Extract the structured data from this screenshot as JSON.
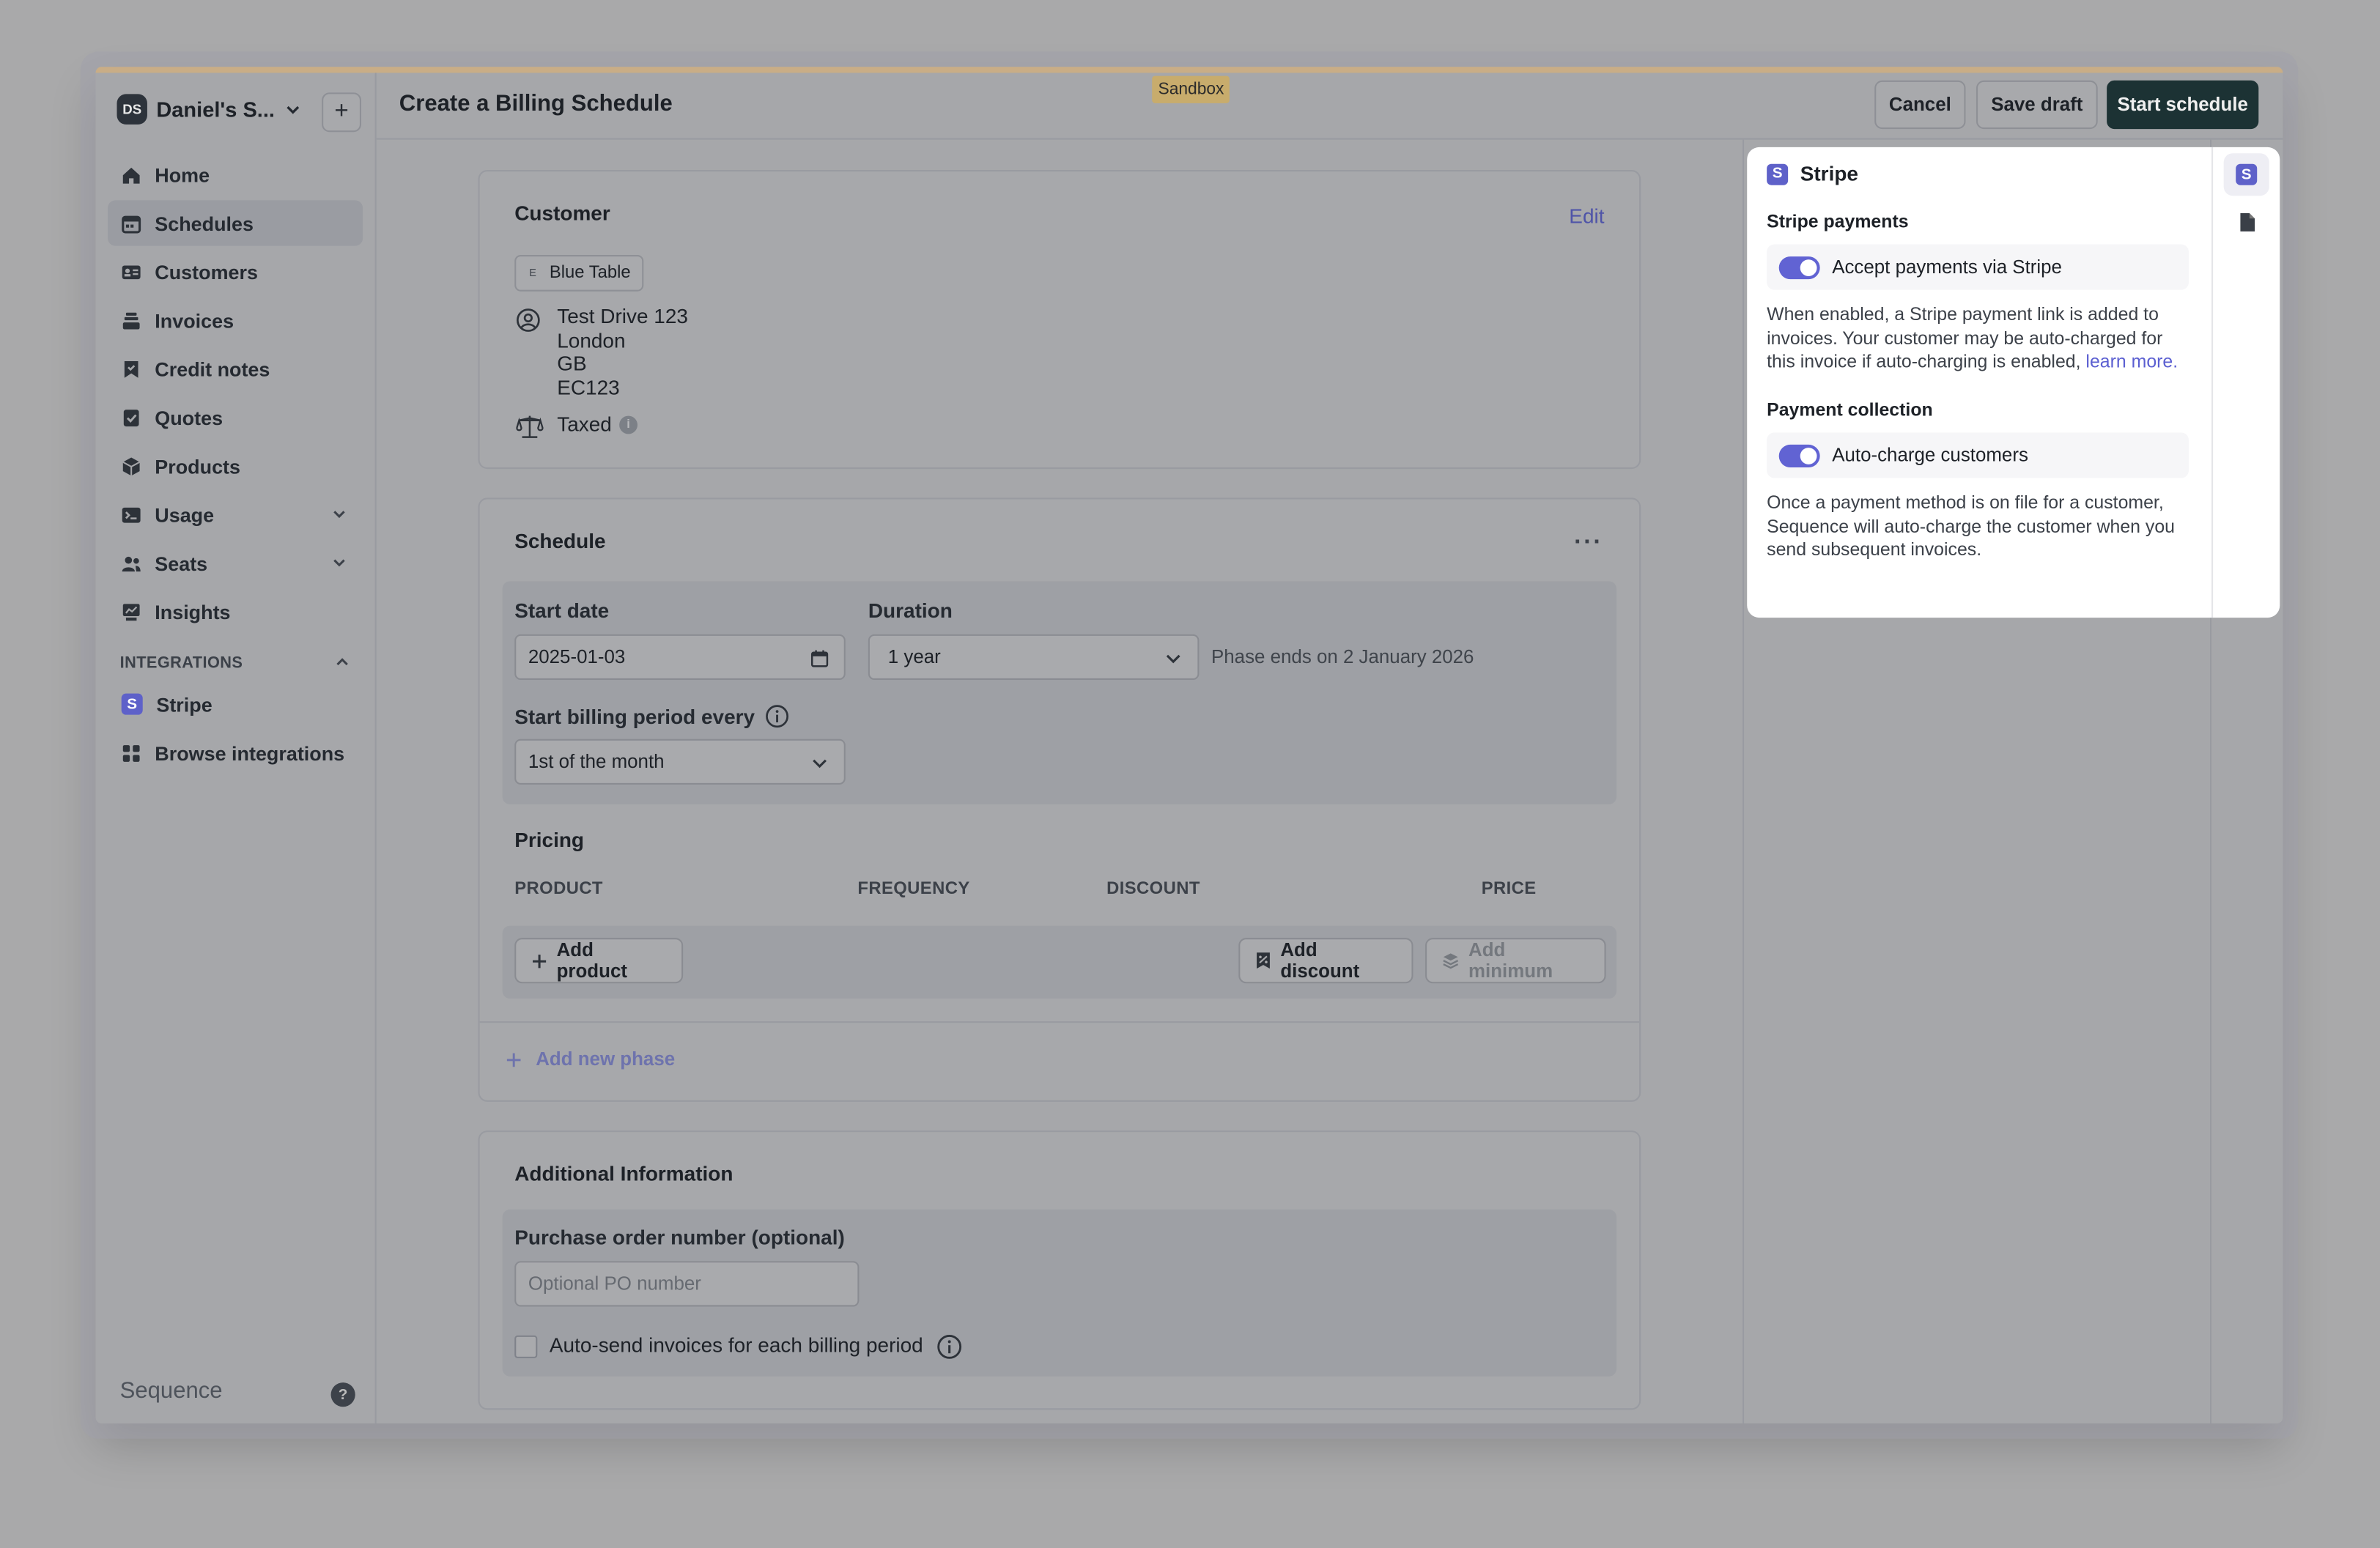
{
  "workspace": {
    "initials": "DS",
    "name": "Daniel's S..."
  },
  "nav": {
    "items": [
      {
        "label": "Home",
        "icon": "home-icon"
      },
      {
        "label": "Schedules",
        "icon": "calendar-icon",
        "active": true
      },
      {
        "label": "Customers",
        "icon": "id-card-icon"
      },
      {
        "label": "Invoices",
        "icon": "stack-icon"
      },
      {
        "label": "Credit notes",
        "icon": "bookmark-note-icon"
      },
      {
        "label": "Quotes",
        "icon": "check-doc-icon"
      },
      {
        "label": "Products",
        "icon": "box-icon"
      },
      {
        "label": "Usage",
        "icon": "terminal-icon"
      },
      {
        "label": "Seats",
        "icon": "people-icon"
      },
      {
        "label": "Insights",
        "icon": "chart-icon"
      }
    ],
    "section_label": "INTEGRATIONS",
    "integrations": [
      {
        "label": "Stripe",
        "icon": "stripe-icon"
      },
      {
        "label": "Browse integrations",
        "icon": "grid-icon"
      }
    ]
  },
  "brand": "Sequence",
  "header": {
    "title": "Create a Billing Schedule",
    "sandbox": "Sandbox",
    "cancel": "Cancel",
    "save_draft": "Save draft",
    "start_schedule": "Start schedule"
  },
  "customer": {
    "title": "Customer",
    "edit": "Edit",
    "chip_initial": "E",
    "chip_name": "Blue Table",
    "address": [
      "Test Drive 123",
      "London",
      "GB",
      "EC123"
    ],
    "tax": "Taxed"
  },
  "schedule": {
    "title": "Schedule",
    "start_date_label": "Start date",
    "start_date_value": "2025-01-03",
    "duration_label": "Duration",
    "duration_value": "1 year",
    "phase_ends": "Phase ends on 2 January 2026",
    "billing_period_label": "Start billing period every",
    "billing_period_value": "1st of the month",
    "pricing_title": "Pricing",
    "columns": [
      "PRODUCT",
      "FREQUENCY",
      "DISCOUNT",
      "PRICE"
    ],
    "add_product": "Add product",
    "add_discount": "Add discount",
    "add_minimum": "Add minimum",
    "add_phase": "Add new phase"
  },
  "additional": {
    "title": "Additional Information",
    "po_label": "Purchase order number (optional)",
    "po_placeholder": "Optional PO number",
    "autosend_label": "Auto-send invoices for each billing period"
  },
  "stripe_panel": {
    "title": "Stripe",
    "payments_heading": "Stripe payments",
    "payments_toggle": "Accept payments via Stripe",
    "payments_desc": "When enabled, a Stripe payment link is added to invoices. Your customer may be auto-charged for this invoice if auto-charging is enabled,",
    "learn_more": "learn more.",
    "collection_heading": "Payment collection",
    "collection_toggle": "Auto-charge customers",
    "collection_desc": "Once a payment method is on file for a customer, Sequence will auto-charge the customer when you send subsequent invoices."
  },
  "colors": {
    "accent": "#6163d3",
    "primary_button": "#1c3234",
    "sandbox": "#c8ac6c"
  }
}
